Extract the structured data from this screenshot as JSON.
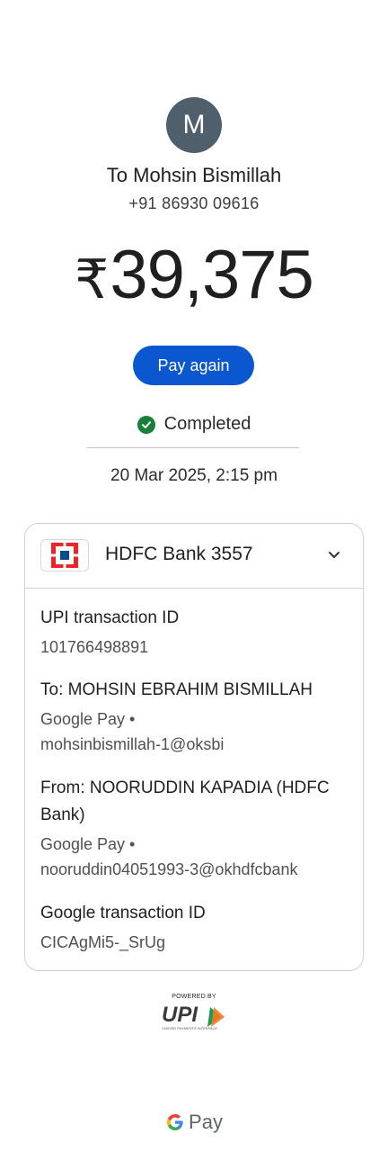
{
  "payee": {
    "avatar_initial": "M",
    "name": "To Mohsin Bismillah",
    "phone": "+91 86930 09616"
  },
  "amount": {
    "currency_symbol": "₹",
    "value": "39,375"
  },
  "actions": {
    "pay_again_label": "Pay again"
  },
  "status": {
    "text": "Completed",
    "color": "#188038"
  },
  "datetime": "20 Mar 2025, 2:15 pm",
  "details_card": {
    "bank_name": "HDFC Bank 3557",
    "upi_txn_label": "UPI transaction ID",
    "upi_txn_value": "101766498891",
    "to_label": "To: MOHSIN EBRAHIM BISMILLAH",
    "to_app": "Google Pay •",
    "to_upi_id": "mohsinbismillah-1@oksbi",
    "from_label_line1": "From: NOORUDDIN KAPADIA (HDFC",
    "from_label_line2": "Bank)",
    "from_app": "Google Pay •",
    "from_upi_id": "nooruddin04051993-3@okhdfcbank",
    "google_txn_label": "Google transaction ID",
    "google_txn_value": "CICAgMi5-_SrUg"
  },
  "footer": {
    "powered_by": "POWERED BY",
    "upi_logo_text": "UPI",
    "upi_tagline": "UNIFIED PAYMENTS INTERFACE",
    "brand": "Pay"
  },
  "colors": {
    "accent": "#0b57d0",
    "avatar_bg": "#4f5f6b",
    "hdfc_red": "#ed232a",
    "hdfc_blue": "#004c8f"
  }
}
